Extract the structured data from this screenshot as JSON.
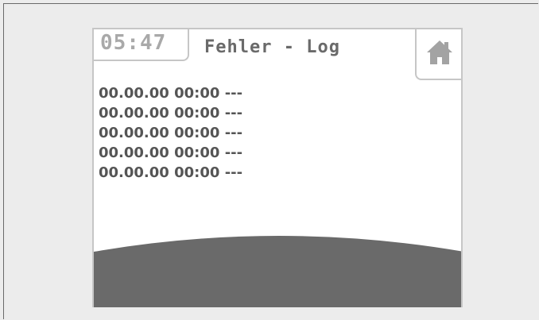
{
  "header": {
    "clock": "05:47",
    "title": "Fehler - Log",
    "home_icon": "home-icon"
  },
  "log": {
    "entries": [
      {
        "date": "00.00.00",
        "time": "00:00",
        "message": "---"
      },
      {
        "date": "00.00.00",
        "time": "00:00",
        "message": "---"
      },
      {
        "date": "00.00.00",
        "time": "00:00",
        "message": "---"
      },
      {
        "date": "00.00.00",
        "time": "00:00",
        "message": "---"
      },
      {
        "date": "00.00.00",
        "time": "00:00",
        "message": "---"
      }
    ]
  },
  "colors": {
    "background": "#ececec",
    "screen": "#ffffff",
    "accent_gray": "#6a6a6a",
    "clock_gray": "#a9a9a9",
    "border_gray": "#c6c6c6"
  }
}
